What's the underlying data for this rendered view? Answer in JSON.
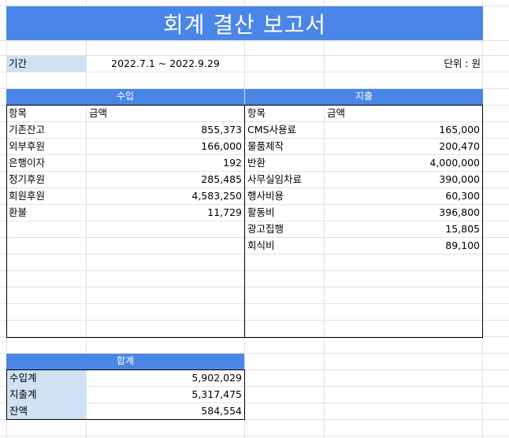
{
  "title": "회계 결산 보고서",
  "period": {
    "label": "기간",
    "value": "2022.7.1 ~ 2022.9.29",
    "unit": "단위 : 원"
  },
  "income": {
    "header": "수입",
    "col_item": "항목",
    "col_amount": "금액",
    "rows": [
      {
        "item": "기존잔고",
        "amount": "855,373"
      },
      {
        "item": "외부후원",
        "amount": "166,000"
      },
      {
        "item": "은행이자",
        "amount": "192"
      },
      {
        "item": "정기후원",
        "amount": "285,485"
      },
      {
        "item": "회원후원",
        "amount": "4,583,250"
      },
      {
        "item": "환불",
        "amount": "11,729"
      }
    ]
  },
  "expense": {
    "header": "지출",
    "col_item": "항목",
    "col_amount": "금액",
    "rows": [
      {
        "item": "CMS사용료",
        "amount": "165,000"
      },
      {
        "item": "물품제작",
        "amount": "200,470"
      },
      {
        "item": "반환",
        "amount": "4,000,000"
      },
      {
        "item": "사무실임차료",
        "amount": "390,000"
      },
      {
        "item": "행사비용",
        "amount": "60,300"
      },
      {
        "item": "활동비",
        "amount": "396,800"
      },
      {
        "item": "광고집행",
        "amount": "15,805"
      },
      {
        "item": "회식비",
        "amount": "89,100"
      }
    ]
  },
  "summary": {
    "header": "합계",
    "rows": [
      {
        "label": "수입계",
        "value": "5,902,029"
      },
      {
        "label": "지출계",
        "value": "5,317,475"
      },
      {
        "label": "잔액",
        "value": "584,554"
      }
    ]
  },
  "colors": {
    "header": "#4a86e8",
    "label_fill": "#cfe2f3",
    "grid": "#e2e2e2"
  }
}
